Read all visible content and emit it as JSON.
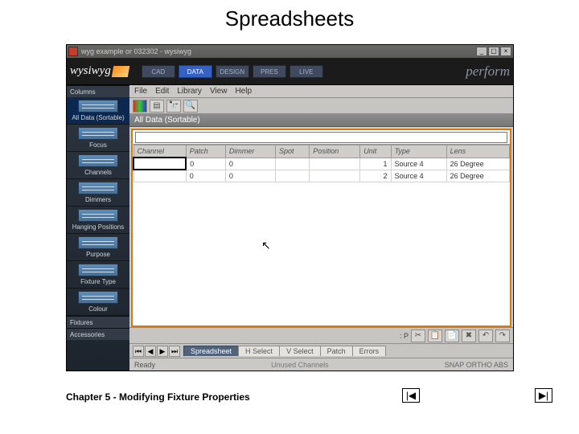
{
  "slide": {
    "title": "Spreadsheets",
    "chapter": "Chapter 5 - Modifying Fixture Properties",
    "nav_prev": "|◀",
    "nav_next": "▶|"
  },
  "window": {
    "title": "wyg example or 032302 - wysiwyg",
    "logo_left": "wysiwyg",
    "logo_right": "perform",
    "min": "_",
    "max": "▢",
    "close": "×"
  },
  "modes": {
    "items": [
      "CAD",
      "DATA",
      "DESIGN",
      "PRES",
      "LIVE"
    ],
    "active": "DATA"
  },
  "sidebar": {
    "group1_label": "Columns",
    "items": [
      "All Data (Sortable)",
      "Focus",
      "Channels",
      "Dimmers",
      "Hanging Positions",
      "Purpose",
      "Fixture Type",
      "Colour"
    ],
    "group2_label": "Fixtures",
    "footer_item": "Accessories"
  },
  "menubar": [
    "File",
    "Edit",
    "Library",
    "View",
    "Help"
  ],
  "pane_title": "All Data (Sortable)",
  "sheet": {
    "headers": [
      "Channel",
      "Patch",
      "Dimmer",
      "Spot",
      "Position",
      "Unit",
      "Type",
      "Lens"
    ],
    "rows": [
      {
        "Channel": "",
        "Patch": "0",
        "Dimmer": "0",
        "Spot": "",
        "Position": "",
        "Unit": "1",
        "Type": "Source 4",
        "Lens": "26 Degree"
      },
      {
        "Channel": "",
        "Patch": "0",
        "Dimmer": "0",
        "Spot": "",
        "Position": "",
        "Unit": "2",
        "Type": "Source 4",
        "Lens": "26 Degree"
      }
    ]
  },
  "bottom_tool": {
    "p_label": ": P",
    "icons": [
      "✂",
      "📋",
      "📄",
      "✖",
      "↶",
      "↷"
    ]
  },
  "bottom_tabs": {
    "nav": [
      "⏮",
      "◀",
      "▶",
      "⏭"
    ],
    "tabs": [
      "Spreadsheet",
      "H Select",
      "V Select",
      "Patch",
      "Errors"
    ],
    "active": "Spreadsheet"
  },
  "statusbar": {
    "left": "Ready",
    "mid": "Unused Channels",
    "right": "SNAP  ORTHO  ABS"
  }
}
